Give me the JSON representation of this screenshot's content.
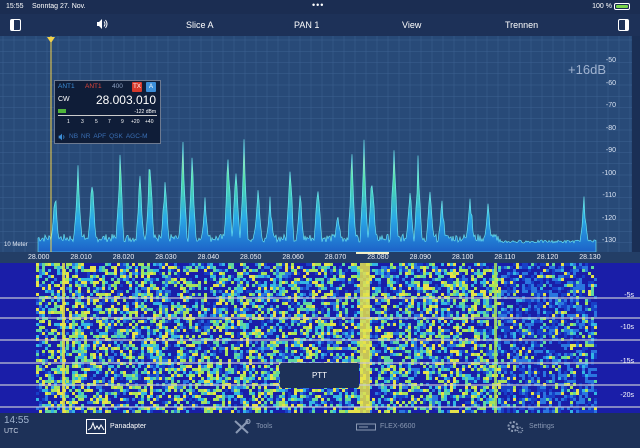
{
  "status": {
    "time": "15:55",
    "date": "Sonntag 27. Nov.",
    "dots": "•••",
    "battery_text": "100 %",
    "battery_level": 1.0
  },
  "menu": {
    "slice": "Slice A",
    "pan": "PAN 1",
    "view": "View",
    "split": "Trennen"
  },
  "panadapter": {
    "ref_level": "+16dB",
    "db_labels": [
      "-50",
      "-60",
      "-70",
      "-80",
      "-90",
      "-100",
      "-110",
      "-120",
      "-130"
    ],
    "meter_label": "10 Meter",
    "colors": {
      "background": "#284a78",
      "trace": "#37d3f0",
      "peak": "#f3d24a"
    }
  },
  "slice_box": {
    "ant1": "ANT1",
    "ant2": "ANT1",
    "width": "400",
    "tx": "TX",
    "a": "A",
    "mode": "CW",
    "frequency": "28.003.010",
    "dbm": "-122 dBm",
    "scale": [
      "1",
      "3",
      "5",
      "7",
      "9",
      "+20",
      "+40"
    ],
    "options": [
      "NB",
      "NR",
      "APF",
      "QSK",
      "AGC-M"
    ],
    "s_meter_level": 0.08
  },
  "freq_axis": {
    "ticks": [
      "28.000",
      "28.010",
      "28.020",
      "28.030",
      "28.040",
      "28.050",
      "28.060",
      "28.070",
      "28.080",
      "28.090",
      "28.100",
      "28.110",
      "28.120",
      "28.130"
    ]
  },
  "waterfall": {
    "time_labels": [
      "-5s",
      "-10s",
      "-15s",
      "-20s"
    ],
    "ptt": "PTT"
  },
  "tabbar": {
    "utc_time": "14:55",
    "utc_label": "UTC",
    "tabs": [
      {
        "label": "Panadapter",
        "icon": "panadapter-icon",
        "active": true
      },
      {
        "label": "Tools",
        "icon": "tools-icon",
        "active": false
      },
      {
        "label": "FLEX-6600",
        "icon": "radio-icon",
        "active": false
      },
      {
        "label": "Settings",
        "icon": "gear-icon",
        "active": false
      }
    ]
  }
}
